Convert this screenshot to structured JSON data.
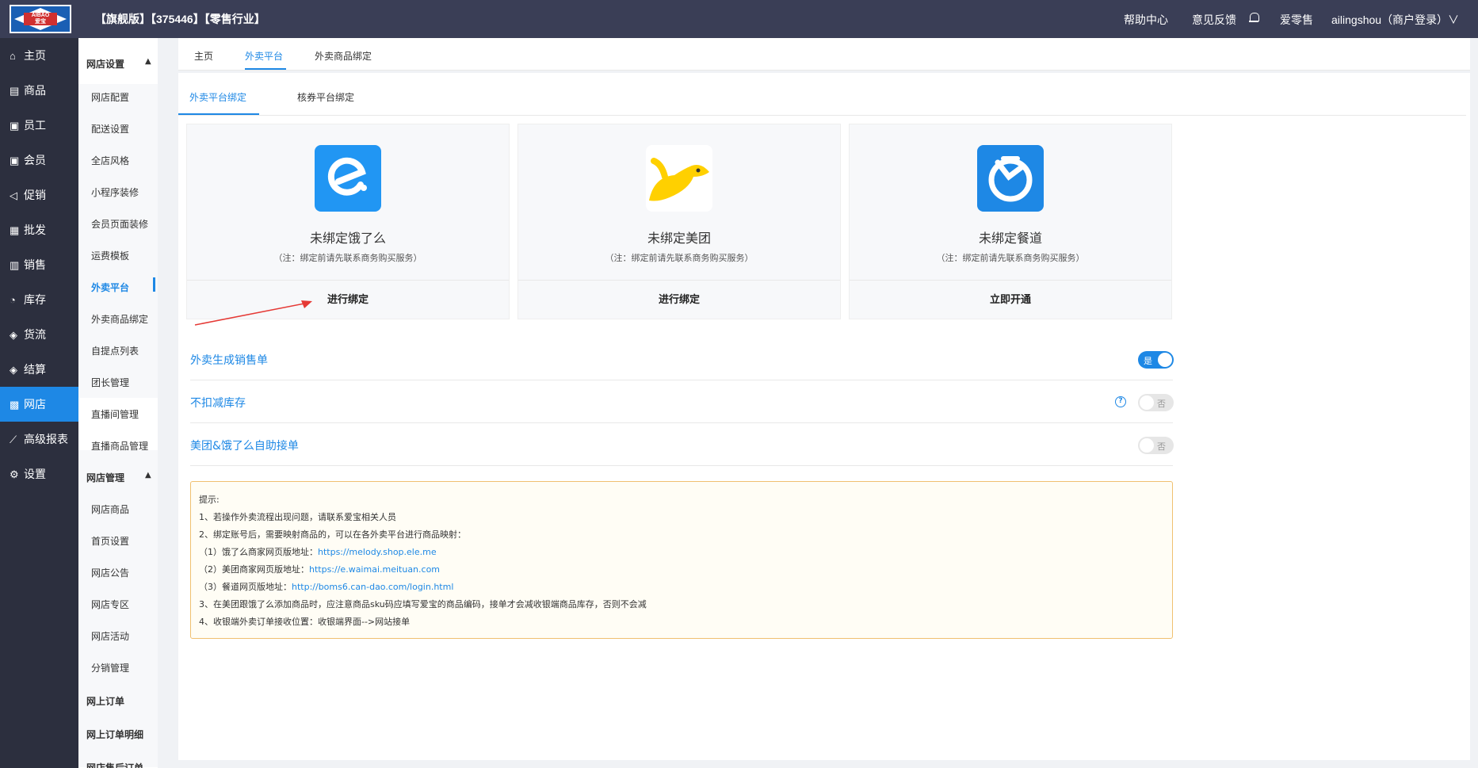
{
  "logo": {
    "text_top": "AIBAO",
    "text_bottom": "爱宝"
  },
  "header": {
    "title": "【旗舰版】【375446】【零售行业】",
    "help": "帮助中心",
    "feedback": "意见反馈",
    "store": "爱零售",
    "user": "ailingshou（商户登录）∨"
  },
  "sidebar": [
    {
      "icon": "⌂",
      "label": "主页"
    },
    {
      "icon": "▤",
      "label": "商品"
    },
    {
      "icon": "▣",
      "label": "员工"
    },
    {
      "icon": "▣",
      "label": "会员"
    },
    {
      "icon": "◁",
      "label": "促销"
    },
    {
      "icon": "▦",
      "label": "批发"
    },
    {
      "icon": "▥",
      "label": "销售"
    },
    {
      "icon": "◔",
      "label": "库存"
    },
    {
      "icon": "◈",
      "label": "货流"
    },
    {
      "icon": "◈",
      "label": "结算"
    },
    {
      "icon": "▩",
      "label": "网店"
    },
    {
      "icon": "⟋",
      "label": "高级报表"
    },
    {
      "icon": "⚙",
      "label": "设置"
    }
  ],
  "submenu": {
    "group1": "网店设置",
    "items1": [
      "网店配置",
      "配送设置",
      "全店风格",
      "小程序装修",
      "会员页面装修",
      "运费模板",
      "外卖平台",
      "外卖商品绑定",
      "自提点列表",
      "团长管理",
      "直播间管理",
      "直播商品管理"
    ],
    "group2": "网店管理",
    "items2": [
      "网店商品",
      "首页设置",
      "网店公告",
      "网店专区",
      "网店活动",
      "分销管理"
    ],
    "extra": [
      "网上订单",
      "网上订单明细",
      "网店售后订单"
    ]
  },
  "tabs": [
    "主页",
    "外卖平台",
    "外卖商品绑定"
  ],
  "subtabs": [
    "外卖平台绑定",
    "核券平台绑定"
  ],
  "cards": [
    {
      "name": "未绑定饿了么",
      "note": "（注：绑定前请先联系商务购买服务）",
      "button": "进行绑定"
    },
    {
      "name": "未绑定美团",
      "note": "（注：绑定前请先联系商务购买服务）",
      "button": "进行绑定"
    },
    {
      "name": "未绑定餐道",
      "note": "（注：绑定前请先联系商务购买服务）",
      "button": "立即开通"
    }
  ],
  "settings": [
    {
      "label": "外卖生成销售单",
      "state": "是"
    },
    {
      "label": "不扣减库存",
      "state": "否"
    },
    {
      "label": "美团&饿了么自助接单",
      "state": "否"
    }
  ],
  "tips": {
    "title": "提示:",
    "l1": "1、若操作外卖流程出现问题，请联系爱宝相关人员",
    "l2": "2、绑定账号后，需要映射商品的，可以在各外卖平台进行商品映射：",
    "l3a": "（1）饿了么商家网页版地址：",
    "l3b": "https://melody.shop.ele.me",
    "l4a": "（2）美团商家网页版地址：",
    "l4b": "https://e.waimai.meituan.com",
    "l5a": "（3）餐道网页版地址：",
    "l5b": "http://boms6.can-dao.com/login.html",
    "l6": "3、在美团跟饿了么添加商品时，应注意商品sku码应填写爱宝的商品编码，接单才会减收银端商品库存，否则不会减",
    "l7": "4、收银端外卖订单接收位置：收银端界面-->网站接单"
  },
  "colors": {
    "accent": "#1e88e5",
    "topbar": "#3a3e56",
    "sidebar": "#2c2f3e",
    "eleme": "#2196f3",
    "meituan": "#ffd000",
    "candao": "#1e88e5"
  }
}
